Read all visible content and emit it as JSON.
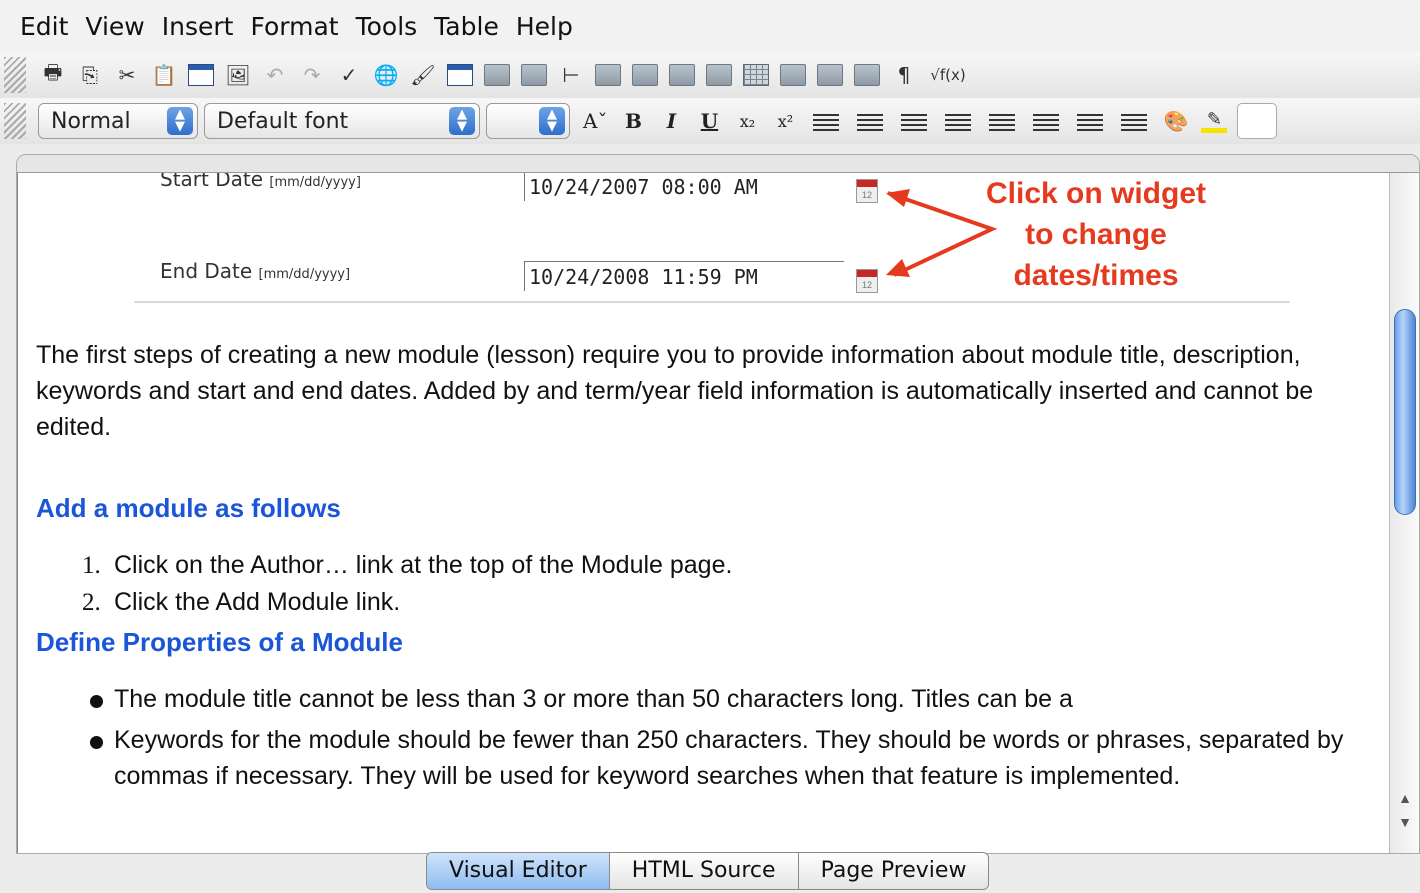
{
  "menu": [
    "Edit",
    "View",
    "Insert",
    "Format",
    "Tools",
    "Table",
    "Help"
  ],
  "toolbar2": {
    "style_select": "Normal",
    "font_select": "Default font",
    "size_select": "",
    "bold": "B",
    "italic": "I",
    "underline": "U",
    "subscript": "x₂",
    "superscript": "x²",
    "pilcrow": "¶",
    "formula": "√f(x)"
  },
  "form": {
    "start_label": "Start Date",
    "start_hint": "[mm/dd/yyyy]",
    "start_value": "10/24/2007 08:00 AM",
    "end_label": "End Date",
    "end_hint": "[mm/dd/yyyy]",
    "end_value": "10/24/2008 11:59 PM"
  },
  "annotation": {
    "line1": "Click on widget",
    "line2": "to change",
    "line3": "dates/times",
    "color": "#e53a1e"
  },
  "content": {
    "intro": "The first steps of creating a new module (lesson) require you to provide information about module title, description, keywords and start and end dates. Added by and term/year field information is automatically inserted and cannot be edited.",
    "heading1": "Add a module as follows",
    "steps": [
      {
        "num": "1.",
        "text": "Click on the Author… link at the top of the Module page."
      },
      {
        "num": "2.",
        "text": "Click the Add Module link."
      }
    ],
    "heading2": "Define Properties of a Module",
    "bullets": [
      "The module title cannot be less than 3 or more than 50 characters long. Titles can be a",
      "Keywords for the module should be fewer than 250 characters. They should be words or phrases, separated by commas if necessary. They will be used for keyword searches when that feature is implemented."
    ]
  },
  "tabs": [
    "Visual Editor",
    "HTML Source",
    "Page Preview"
  ],
  "colors": {
    "heading": "#1b55d8",
    "active_tab": "#8fbcf0"
  }
}
